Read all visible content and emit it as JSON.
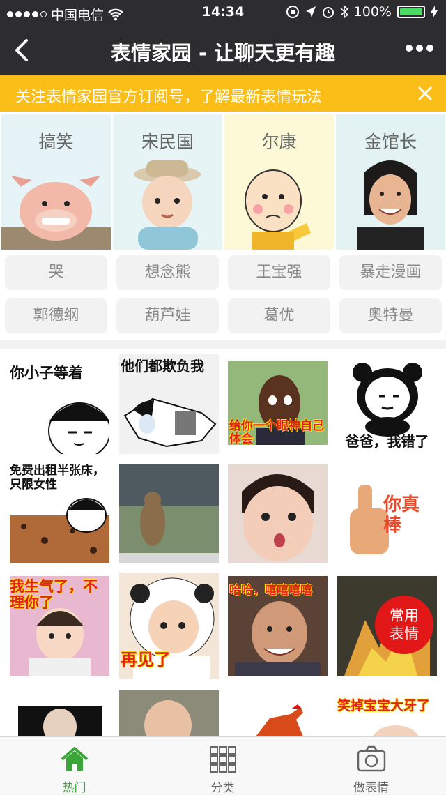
{
  "status": {
    "carrier": "中国电信",
    "time": "14:34",
    "battery": "100%"
  },
  "nav": {
    "title": "表情家园 - 让聊天更有趣"
  },
  "notice": {
    "text": "关注表情家园官方订阅号，了解最新表情玩法"
  },
  "categories": [
    {
      "label": "搞笑",
      "bg": "#e7f4f7"
    },
    {
      "label": "宋民国",
      "bg": "#e6f4f6"
    },
    {
      "label": "尔康",
      "bg": "#fdf8d5"
    },
    {
      "label": "金馆长",
      "bg": "#e3f3f3"
    }
  ],
  "tags": [
    "哭",
    "想念熊",
    "王宝强",
    "暴走漫画",
    "郭德纲",
    "葫芦娃",
    "葛优",
    "奥特曼"
  ],
  "stickers": [
    {
      "caption": "你小子等着"
    },
    {
      "caption": "他们都欺负我"
    },
    {
      "caption": "给你一个眼神自己体会"
    },
    {
      "caption": "爸爸，我错了"
    },
    {
      "caption": "免费出租半张床，只限女性"
    },
    {
      "caption": ""
    },
    {
      "caption": ""
    },
    {
      "caption": "你真棒"
    },
    {
      "caption": "我生气了，不理你了"
    },
    {
      "caption": "再见了"
    },
    {
      "caption": "哈哈，嘻嘻嘻嘻"
    },
    {
      "caption": ""
    },
    {
      "caption": ""
    },
    {
      "caption": ""
    },
    {
      "caption": ""
    },
    {
      "caption": "笑掉宝宝大牙了"
    }
  ],
  "fab": {
    "line1": "常用",
    "line2": "表情"
  },
  "tabbar": [
    {
      "label": "热门",
      "icon": "home-icon",
      "active": true
    },
    {
      "label": "分类",
      "icon": "grid-icon",
      "active": false
    },
    {
      "label": "做表情",
      "icon": "camera-icon",
      "active": false
    }
  ],
  "colors": {
    "accent": "#3aa637",
    "notice": "#fbbd17",
    "fab": "#e11718",
    "bar": "#2d2d2f"
  }
}
